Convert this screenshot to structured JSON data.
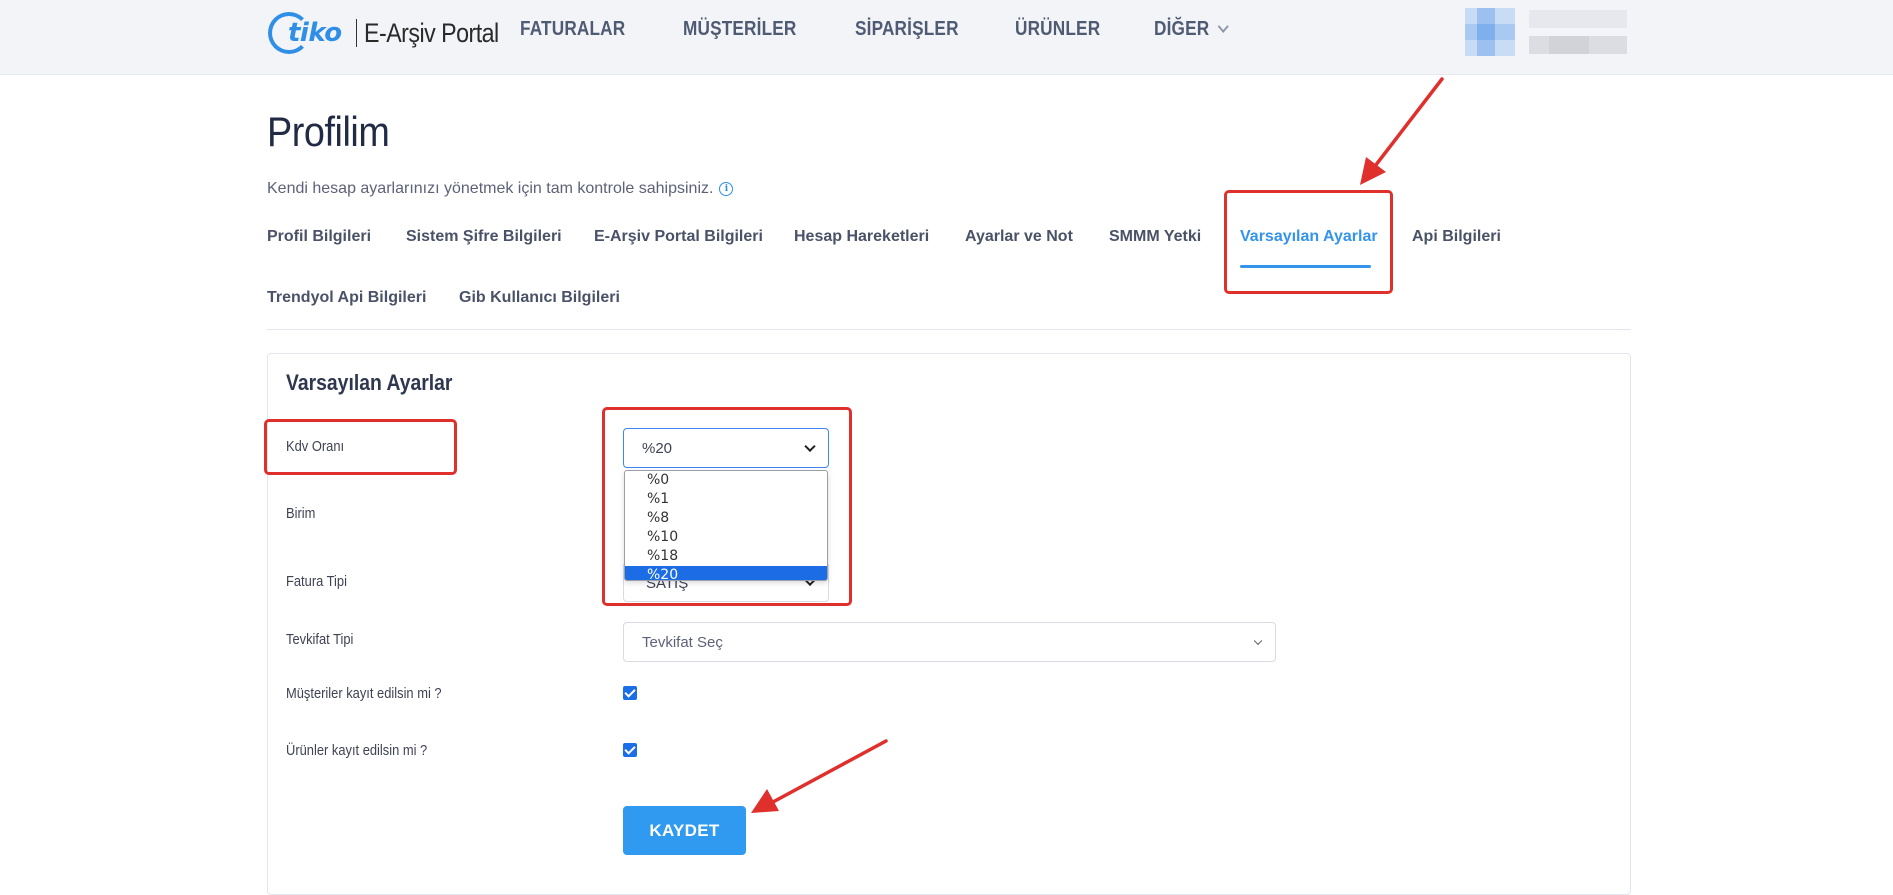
{
  "header": {
    "logo_brand": "tiko",
    "logo_product": "E-Arşiv Portal",
    "nav": [
      "FATURALAR",
      "MÜŞTERİLER",
      "SİPARİŞLER",
      "ÜRÜNLER",
      "DİĞER"
    ]
  },
  "page": {
    "title": "Profilim",
    "subtitle": "Kendi hesap ayarlarınızı yönetmek için tam kontrole sahipsiniz."
  },
  "tabs": [
    "Profil Bilgileri",
    "Sistem Şifre Bilgileri",
    "E-Arşiv Portal Bilgileri",
    "Hesap Hareketleri",
    "Ayarlar ve Not",
    "SMMM Yetki",
    "Varsayılan Ayarlar",
    "Api Bilgileri",
    "Trendyol Api Bilgileri",
    "Gib Kullanıcı Bilgileri"
  ],
  "active_tab": "Varsayılan Ayarlar",
  "form": {
    "title": "Varsayılan Ayarlar",
    "kdv_label": "Kdv Oranı",
    "kdv_value": "%20",
    "kdv_options": [
      "%0",
      "%1",
      "%8",
      "%10",
      "%18",
      "%20"
    ],
    "birim_label": "Birim",
    "fatura_tipi_label": "Fatura Tipi",
    "fatura_tipi_value_partial": "SATIŞ",
    "tevkifat_label": "Tevkifat Tipi",
    "tevkifat_placeholder": "Tevkifat Seç",
    "musteri_kayit_label": "Müşteriler kayıt edilsin mi ?",
    "musteri_kayit_checked": true,
    "urun_kayit_label": "Ürünler kayıt edilsin mi ?",
    "urun_kayit_checked": true,
    "save_label": "KAYDET"
  },
  "colors": {
    "accent": "#3394ea",
    "annotation": "#e0302b",
    "selected_option": "#1c6de5"
  },
  "icons": [
    "info-icon",
    "chevron-down-icon",
    "checkbox-checked-icon",
    "arrow-annotation"
  ]
}
